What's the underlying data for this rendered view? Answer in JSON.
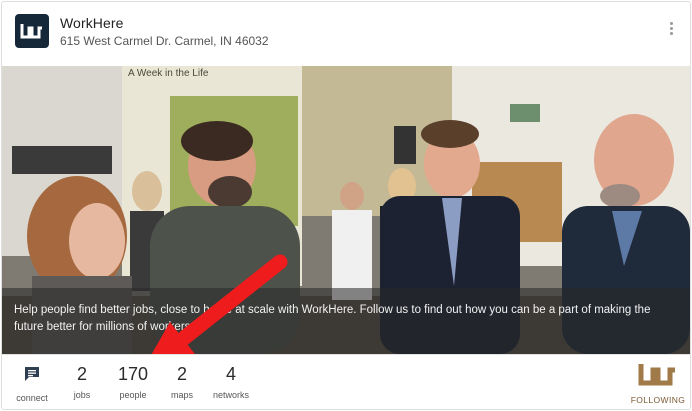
{
  "header": {
    "company_name": "WorkHere",
    "address": "615 West Carmel Dr. Carmel, IN 46032",
    "menu_icon": "more-vertical-icon",
    "logo_icon": "workhere-logo-icon"
  },
  "banner": {
    "caption": "Help people find better jobs, close to home at scale with WorkHere. Follow us to find out how you can be a part of making the future better for millions of workers.",
    "sign_text": "A Week in the Life",
    "overlay_arrow_color": "#ee1c1c"
  },
  "stats": {
    "connect": {
      "label": "connect",
      "icon": "chat-bubble-icon"
    },
    "jobs": {
      "value": "2",
      "label": "jobs"
    },
    "people": {
      "value": "170",
      "label": "people"
    },
    "maps": {
      "value": "2",
      "label": "maps"
    },
    "networks": {
      "value": "4",
      "label": "networks"
    }
  },
  "follow": {
    "label": "FOLLOWING",
    "icon": "workhere-brand-icon",
    "color": "#a07a49"
  },
  "colors": {
    "logo_bg": "#15283a",
    "accent": "#a07a49",
    "arrow": "#ee1c1c"
  }
}
